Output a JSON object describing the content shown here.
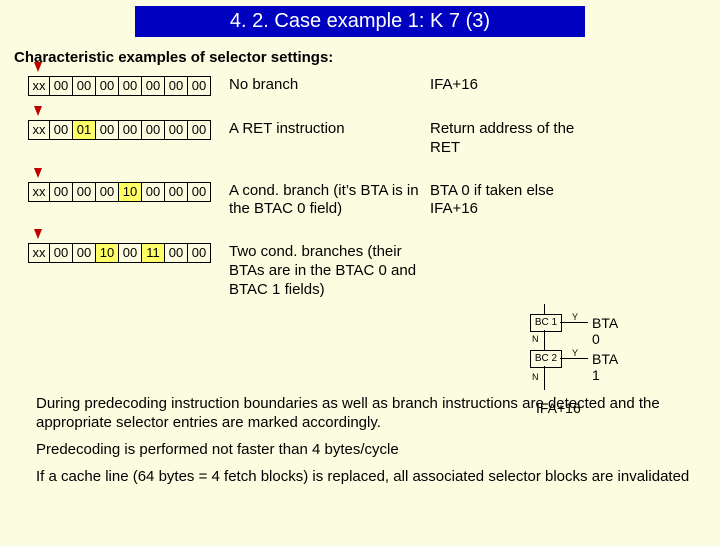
{
  "title": "4. 2. Case example 1: K 7 (3)",
  "subhead": "Characteristic examples of selector settings:",
  "rows": [
    {
      "cells": [
        "xx",
        "00",
        "00",
        "00",
        "00",
        "00",
        "00",
        "00"
      ],
      "hl": [],
      "desc": "No branch",
      "res": "IFA+16"
    },
    {
      "cells": [
        "xx",
        "00",
        "01",
        "00",
        "00",
        "00",
        "00",
        "00"
      ],
      "hl": [
        2
      ],
      "desc": "A RET instruction",
      "res": "Return address of the RET"
    },
    {
      "cells": [
        "xx",
        "00",
        "00",
        "00",
        "10",
        "00",
        "00",
        "00"
      ],
      "hl": [
        4
      ],
      "desc": "A cond. branch (it’s BTA is in the BTAC 0 field)",
      "res": "BTA 0 if taken else IFA+16"
    },
    {
      "cells": [
        "xx",
        "00",
        "00",
        "10",
        "00",
        "11",
        "00",
        "00"
      ],
      "hl": [
        3,
        5
      ],
      "desc": "Two cond. branches (their BTAs are in the BTAC 0 and BTAC 1 fields)",
      "res": ""
    }
  ],
  "flow": {
    "bc1": "BC 1",
    "bc2": "BC 2",
    "y": "Y",
    "n": "N",
    "out1": "BTA 0",
    "out2": "BTA 1",
    "out3": "IFA+16"
  },
  "paras": [
    "During predecoding instruction boundaries as well as branch instructions are detected and the appropriate selector entries are marked accordingly.",
    "Predecoding is performed not faster than 4 bytes/cycle",
    "If a cache line (64 bytes = 4 fetch blocks) is replaced, all associated selector blocks are invalidated"
  ]
}
